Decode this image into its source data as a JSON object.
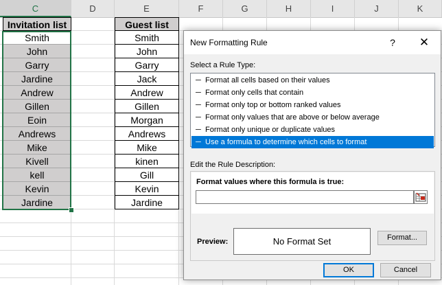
{
  "columns": [
    "C",
    "D",
    "E",
    "F",
    "G",
    "H",
    "I",
    "J",
    "K"
  ],
  "selected_column": "C",
  "invitation_list": {
    "header": "Invitation list",
    "names": [
      "Smith",
      "John",
      "Garry",
      "Jardine",
      "Andrew",
      "Gillen",
      "Eoin",
      "Andrews",
      "Mike",
      "Kivell",
      "kell",
      "Kevin",
      "Jardine"
    ]
  },
  "guest_list": {
    "header": "Guest list",
    "names": [
      "Smith",
      "John",
      "Garry",
      "Jack",
      "Andrew",
      "Gillen",
      "Morgan",
      "Andrews",
      "Mike",
      "kinen",
      "Gill",
      "Kevin",
      "Jardine"
    ]
  },
  "dialog": {
    "title": "New Formatting Rule",
    "help": "?",
    "close": "✕",
    "select_rule_type_label": "Select a Rule Type:",
    "rule_types": [
      "Format all cells based on their values",
      "Format only cells that contain",
      "Format only top or bottom ranked values",
      "Format only values that are above or below average",
      "Format only unique or duplicate values",
      "Use a formula to determine which cells to format"
    ],
    "selected_rule_index": 5,
    "bullet": "─▸",
    "edit_description_label": "Edit the Rule Description:",
    "formula_label": "Format values where this formula is true:",
    "formula_value": "",
    "preview_label": "Preview:",
    "preview_text": "No Format Set",
    "format_button": "Format...",
    "ok_button": "OK",
    "cancel_button": "Cancel"
  },
  "colors": {
    "excel_green": "#217346",
    "selection_blue": "#0078d7",
    "header_fill": "#d0cece"
  }
}
